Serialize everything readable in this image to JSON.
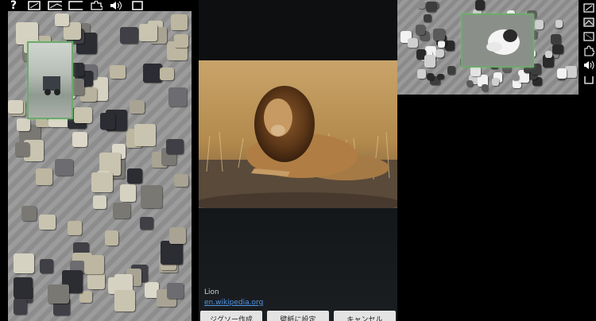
{
  "left_toolbar": {
    "icons": [
      "help-icon",
      "scatter-icon",
      "preview-icon",
      "background-icon",
      "puzzle-piece-icon",
      "sound-icon",
      "fullscreen-icon"
    ],
    "help_glyph": "?"
  },
  "image_info": {
    "caption": "Lion",
    "source_link": "en.wikipedia.org"
  },
  "dialog_buttons": [
    {
      "label": "ジグソー作成"
    },
    {
      "label": "壁紙に設定"
    },
    {
      "label": "キャンセル"
    }
  ],
  "right_toolbar": {
    "icons": [
      "scatter-icon",
      "preview-icon",
      "background-icon",
      "puzzle-piece-icon",
      "sound-icon",
      "fullscreen-icon"
    ]
  },
  "colors": {
    "link": "#4f96e8",
    "preview_border": "#6fa86f",
    "button_bg": "#e3e3e3"
  }
}
